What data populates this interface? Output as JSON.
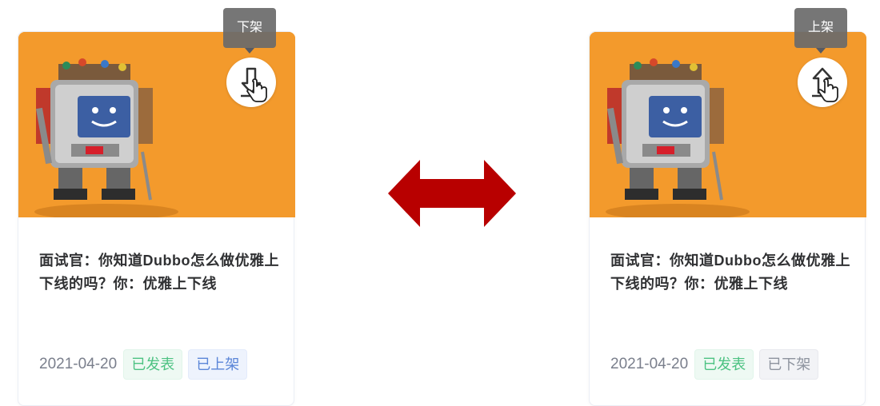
{
  "cards": [
    {
      "tooltip": "下架",
      "action": "unpublish",
      "title": "面试官：你知道Dubbo怎么做优雅上下线的吗？你：优雅上下线",
      "date": "2021-04-20",
      "status_published": "已发表",
      "status_shelf": "已上架"
    },
    {
      "tooltip": "上架",
      "action": "publish",
      "title": "面试官：你知道Dubbo怎么做优雅上下线的吗？你：优雅上下线",
      "date": "2021-04-20",
      "status_published": "已发表",
      "status_shelf": "已下架"
    }
  ],
  "colors": {
    "arrow": "#b80000",
    "cover_bg": "#f39a2c",
    "badge_green_text": "#4cc282",
    "badge_blue_text": "#5b86d8",
    "badge_gray_text": "#8d939e",
    "tooltip_bg": "#6b6b6b"
  },
  "icons": {
    "left_action": "download-arrow-icon",
    "right_action": "upload-arrow-icon",
    "cursor": "hand-pointer-icon",
    "between": "double-arrow-icon"
  }
}
